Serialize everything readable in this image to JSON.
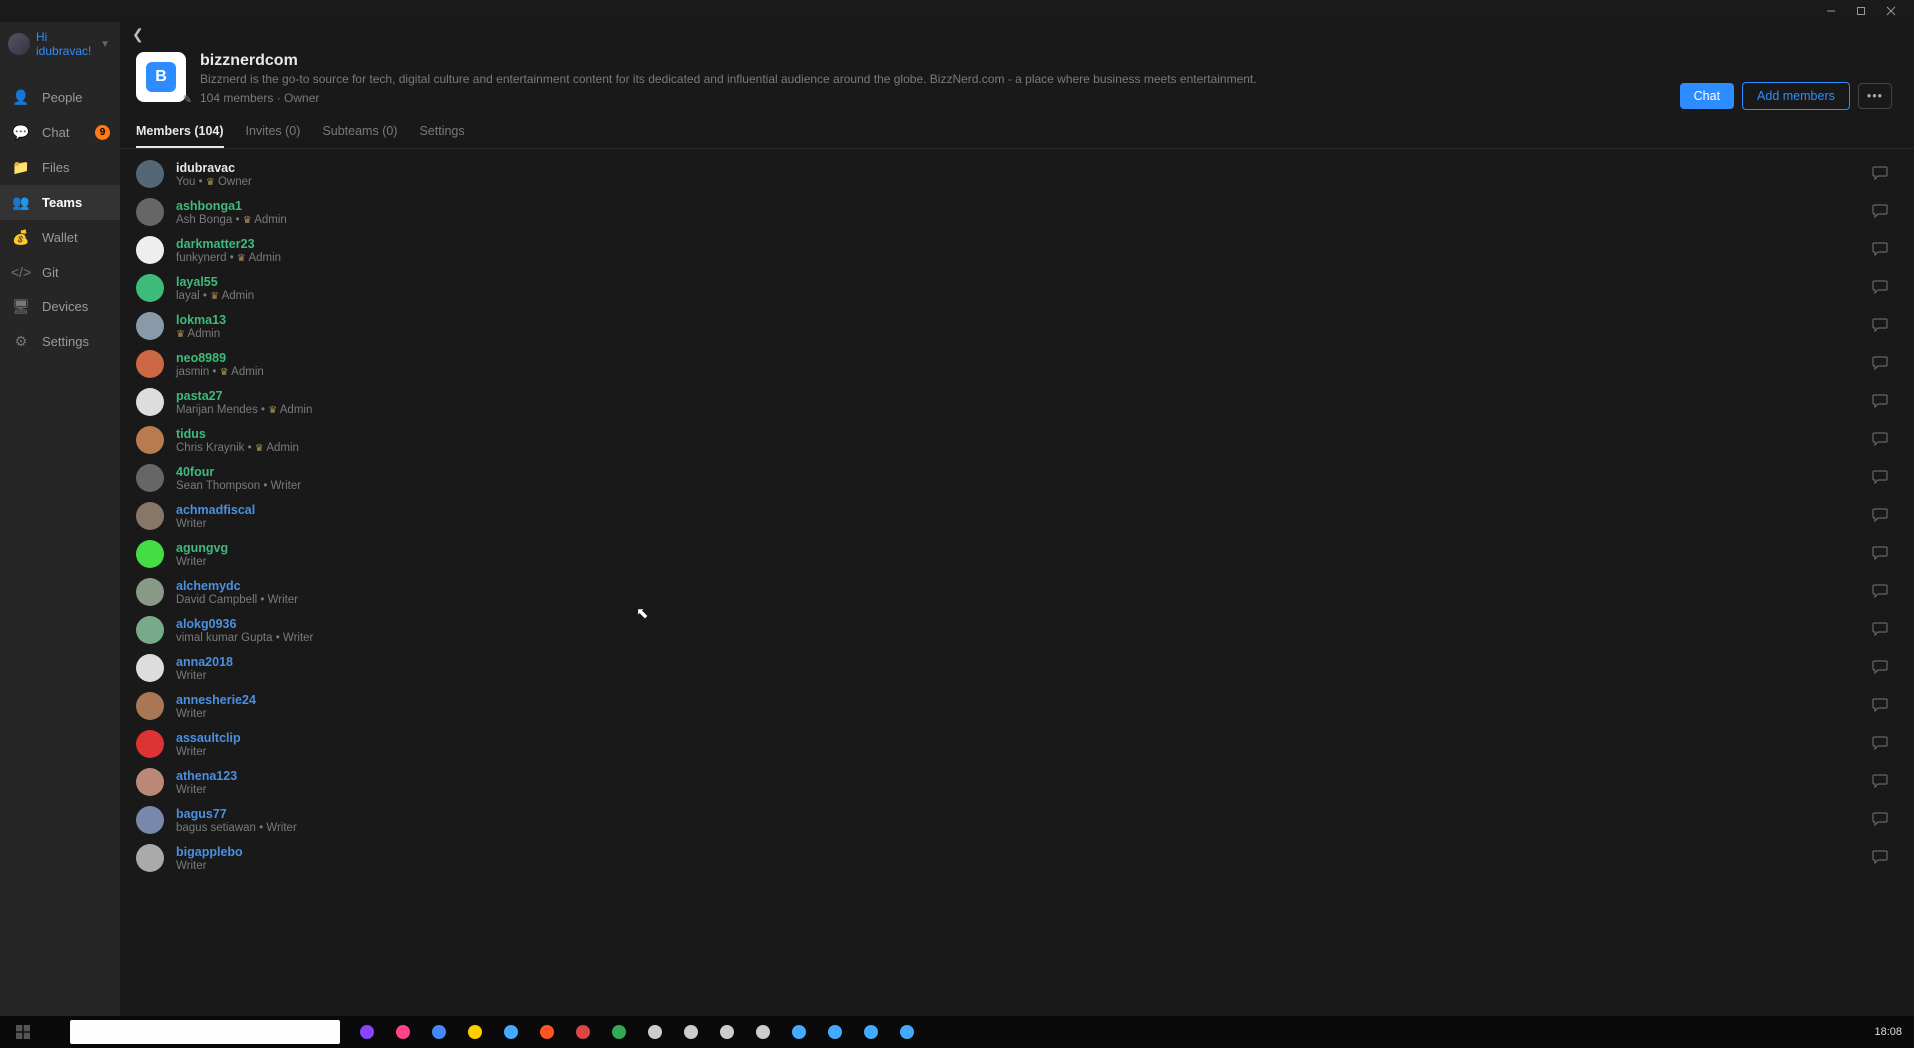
{
  "user": {
    "greeting": "Hi idubravac!"
  },
  "sidebar": {
    "items": [
      {
        "label": "People"
      },
      {
        "label": "Chat",
        "badge": "9"
      },
      {
        "label": "Files"
      },
      {
        "label": "Teams",
        "active": true
      },
      {
        "label": "Wallet"
      },
      {
        "label": "Git"
      },
      {
        "label": "Devices"
      },
      {
        "label": "Settings"
      }
    ]
  },
  "team": {
    "name": "bizznerdcom",
    "logo_letter": "B",
    "description": "Bizznerd is the go-to source for tech, digital culture and entertainment content for its dedicated and influential audience around the globe. BizzNerd.com - a place where business meets entertainment.",
    "meta": "104 members · Owner"
  },
  "actions": {
    "chat": "Chat",
    "add_members": "Add members",
    "more": "•••"
  },
  "tabs": [
    {
      "label": "Members (104)",
      "active": true
    },
    {
      "label": "Invites (0)"
    },
    {
      "label": "Subteams (0)"
    },
    {
      "label": "Settings"
    }
  ],
  "members": [
    {
      "name": "idubravac",
      "nameClass": "self",
      "sub": "You • ",
      "role": "Owner",
      "crown": true,
      "avatarColor": "#556677"
    },
    {
      "name": "ashbonga1",
      "nameClass": "green",
      "sub": "Ash Bonga • ",
      "role": "Admin",
      "crown": true,
      "avatarColor": "#666"
    },
    {
      "name": "darkmatter23",
      "nameClass": "green",
      "sub": "funkynerd • ",
      "role": "Admin",
      "crown": true,
      "avatarColor": "#eee"
    },
    {
      "name": "layal55",
      "nameClass": "green",
      "sub": "layal • ",
      "role": "Admin",
      "crown": true,
      "avatarColor": "#3dbb7a"
    },
    {
      "name": "lokma13",
      "nameClass": "green",
      "sub": "",
      "role": "Admin",
      "crown": true,
      "avatarColor": "#8899aa"
    },
    {
      "name": "neo8989",
      "nameClass": "green",
      "sub": "jasmin • ",
      "role": "Admin",
      "crown": true,
      "avatarColor": "#cc6644"
    },
    {
      "name": "pasta27",
      "nameClass": "green",
      "sub": "Marijan Mendes • ",
      "role": "Admin",
      "crown": true,
      "avatarColor": "#ddd"
    },
    {
      "name": "tidus",
      "nameClass": "green",
      "sub": "Chris Kraynik • ",
      "role": "Admin",
      "crown": true,
      "avatarColor": "#b87a50"
    },
    {
      "name": "40four",
      "nameClass": "green",
      "sub": "Sean Thompson • ",
      "role": "Writer",
      "avatarColor": "#666"
    },
    {
      "name": "achmadfiscal",
      "nameClass": "blue",
      "sub": "",
      "role": "Writer",
      "avatarColor": "#887766"
    },
    {
      "name": "agungvg",
      "nameClass": "green",
      "sub": "",
      "role": "Writer",
      "avatarColor": "#44dd44"
    },
    {
      "name": "alchemydc",
      "nameClass": "blue",
      "sub": "David Campbell • ",
      "role": "Writer",
      "avatarColor": "#889988"
    },
    {
      "name": "alokg0936",
      "nameClass": "blue",
      "sub": "vimal kumar Gupta • ",
      "role": "Writer",
      "avatarColor": "#77aa88"
    },
    {
      "name": "anna2018",
      "nameClass": "blue",
      "sub": "",
      "role": "Writer",
      "avatarColor": "#ddd"
    },
    {
      "name": "annesherie24",
      "nameClass": "blue",
      "sub": "",
      "role": "Writer",
      "avatarColor": "#aa7755"
    },
    {
      "name": "assaultclip",
      "nameClass": "blue",
      "sub": "",
      "role": "Writer",
      "avatarColor": "#dd3333"
    },
    {
      "name": "athena123",
      "nameClass": "blue",
      "sub": "",
      "role": "Writer",
      "avatarColor": "#bb8877"
    },
    {
      "name": "bagus77",
      "nameClass": "blue",
      "sub": "bagus setiawan • ",
      "role": "Writer",
      "avatarColor": "#7788aa"
    },
    {
      "name": "bigapplebo",
      "nameClass": "blue",
      "sub": "",
      "role": "Writer",
      "avatarColor": "#aaa"
    }
  ],
  "sidebar_icons": [
    "👤",
    "💬",
    "📁",
    "👥",
    "💰",
    "</>",
    "🖥",
    "⚙"
  ],
  "clock": "18:08",
  "taskbar_dots": [
    "#8844ff",
    "#ff4488",
    "#4488ff",
    "#ffcc00",
    "#44aaff",
    "#ff5522",
    "#dd4444",
    "#33aa55",
    "#ccc",
    "#ccc",
    "#ccc",
    "#ccc",
    "#4af",
    "#4af",
    "#4af",
    "#4af"
  ]
}
